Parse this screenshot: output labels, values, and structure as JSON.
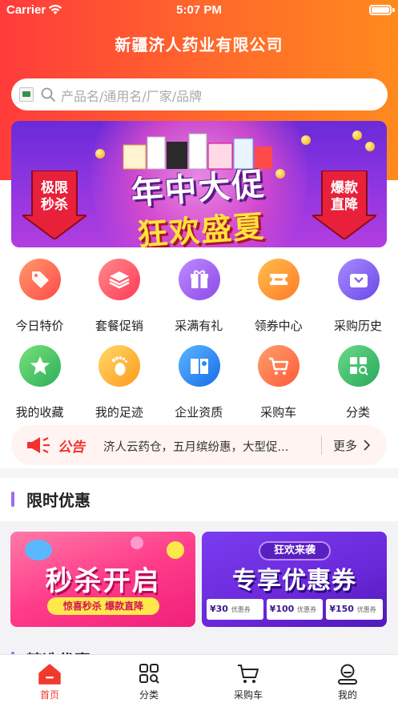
{
  "status_bar": {
    "carrier": "Carrier",
    "time": "5:07 PM"
  },
  "header": {
    "title": "新疆济人药业有限公司"
  },
  "search": {
    "placeholder": "产品名/通用名/厂家/品牌"
  },
  "banner": {
    "line1": "年中大促",
    "line2": "狂欢盛夏",
    "left_tag": "极限\n秒杀",
    "right_tag": "爆款\n直降"
  },
  "menu": {
    "items": [
      {
        "label": "今日特价",
        "icon": "price-tag-icon",
        "color": "#ff6b5a"
      },
      {
        "label": "套餐促销",
        "icon": "layers-icon",
        "color": "#ff5a6e"
      },
      {
        "label": "采满有礼",
        "icon": "gift-icon",
        "color": "#9a5cf0"
      },
      {
        "label": "领券中心",
        "icon": "ticket-icon",
        "color": "#ff8a2a"
      },
      {
        "label": "采购历史",
        "icon": "history-bag-icon",
        "color": "#8a5cf0"
      },
      {
        "label": "我的收藏",
        "icon": "star-icon",
        "color": "#3cc05a"
      },
      {
        "label": "我的足迹",
        "icon": "footprint-icon",
        "color": "#ffb020"
      },
      {
        "label": "企业资质",
        "icon": "certificate-book-icon",
        "color": "#2a8cf0"
      },
      {
        "label": "采购车",
        "icon": "cart-icon",
        "color": "#ff6a3a"
      },
      {
        "label": "分类",
        "icon": "category-grid-icon",
        "color": "#3cb86a"
      }
    ]
  },
  "notice": {
    "tag": "公告",
    "text": "济人云药仓，五月缤纷惠，大型促...",
    "more": "更多"
  },
  "flash_section": {
    "title": "限时优惠"
  },
  "promos": {
    "left": {
      "title": "秒杀开启",
      "subtitle": "惊喜秒杀  爆款直降"
    },
    "right": {
      "top_label": "狂欢来袭",
      "title": "专享优惠券",
      "coupons": [
        {
          "amount": "¥30",
          "label": "优惠券"
        },
        {
          "amount": "¥100",
          "label": "优惠券"
        },
        {
          "amount": "¥150",
          "label": "优惠券"
        }
      ]
    }
  },
  "next_section": {
    "title": "精选优惠"
  },
  "tabbar": {
    "tabs": [
      {
        "label": "首页",
        "icon": "home-icon",
        "active": true
      },
      {
        "label": "分类",
        "icon": "category-icon",
        "active": false
      },
      {
        "label": "采购车",
        "icon": "cart-icon",
        "active": false
      },
      {
        "label": "我的",
        "icon": "profile-icon",
        "active": false
      }
    ]
  },
  "colors": {
    "header_start": "#ff3b3b",
    "header_end": "#ff8a1e",
    "accent_red": "#f03a2c",
    "section_bar": "#9b6cf0"
  }
}
